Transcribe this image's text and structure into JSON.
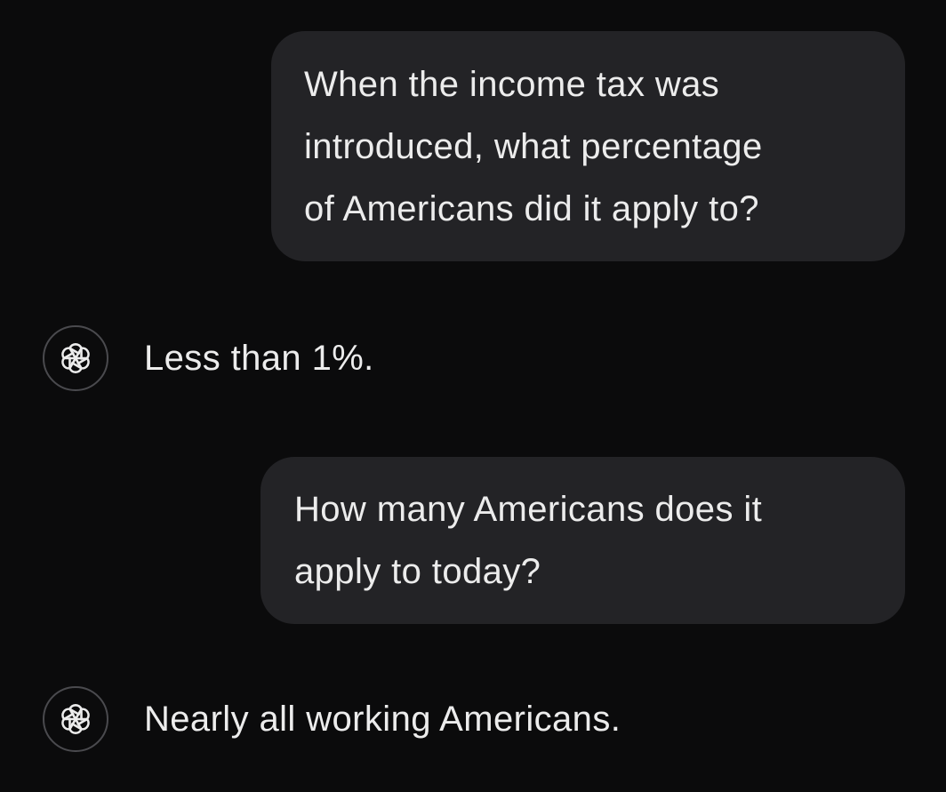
{
  "conversation": {
    "messages": [
      {
        "role": "user",
        "lines": [
          "When the income tax was",
          "introduced, what percentage",
          "of Americans did it apply to?"
        ]
      },
      {
        "role": "assistant",
        "icon": "openai-logo-icon",
        "text": "Less than 1%."
      },
      {
        "role": "user",
        "lines": [
          "How many Americans does it",
          "apply to today?"
        ]
      },
      {
        "role": "assistant",
        "icon": "openai-logo-icon",
        "text": "Nearly all working Americans."
      }
    ]
  },
  "colors": {
    "background": "#0b0b0c",
    "bubble": "#232326",
    "text": "#ececec",
    "avatar_border": "#4a4a4e"
  }
}
